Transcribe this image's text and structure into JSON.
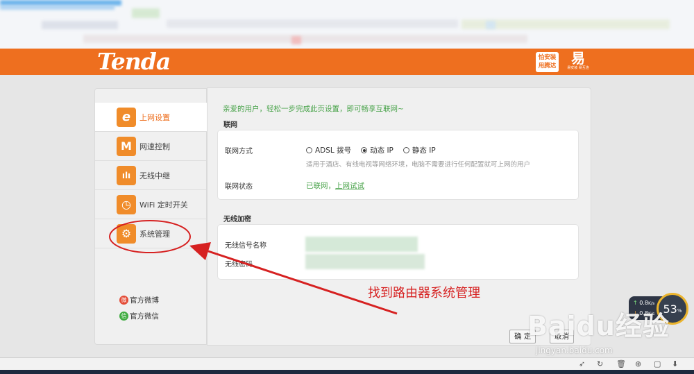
{
  "header": {
    "logo_text": "Tenda",
    "slogan_line1": "怕安装",
    "slogan_line2": "用腾达",
    "brand_icon": "易",
    "brand_sub": "易安装 易互连"
  },
  "sidebar": {
    "items": [
      {
        "label": "上网设置",
        "icon": "ie-e-icon",
        "glyph": "e"
      },
      {
        "label": "网速控制",
        "icon": "speed-wave-icon",
        "glyph": "M"
      },
      {
        "label": "无线中继",
        "icon": "wireless-repeater-icon",
        "glyph": "ılı"
      },
      {
        "label": "WiFi 定时开关",
        "icon": "wifi-timer-icon",
        "glyph": "◷"
      },
      {
        "label": "系统管理",
        "icon": "gear-icon",
        "glyph": "⚙"
      }
    ],
    "links": [
      {
        "label": "官方微博",
        "glyph": "微"
      },
      {
        "label": "官方微信",
        "glyph": "信"
      }
    ]
  },
  "main": {
    "welcome": "亲爱的用户，轻松一步完成此页设置，即可畅享互联网~",
    "internet": {
      "section_title": "联网",
      "mode_label": "联网方式",
      "options": [
        "ADSL 拨号",
        "动态 IP",
        "静态 IP"
      ],
      "selected": "动态 IP",
      "hint": "适用于酒店、有线电视等网络环境，电脑不需要进行任何配置就可上网的用户",
      "status_label": "联网状态",
      "status_text": "已联网，",
      "status_link": "上网试试"
    },
    "wireless": {
      "section_title": "无线加密",
      "ssid_label": "无线信号名称",
      "password_label": "无线密码"
    },
    "buttons": {
      "ok": "确 定",
      "cancel": "取消"
    }
  },
  "annotation": {
    "text": "找到路由器系统管理",
    "color": "#d62121"
  },
  "speed_widget": {
    "up": "0.8",
    "down": "0.8",
    "unit": "K/s",
    "percent": "53",
    "percent_sign": "%"
  },
  "watermark": {
    "main": "Baidu经验",
    "sub": "jingyan.baidu.com"
  },
  "colors": {
    "header_orange": "#ee6f1f",
    "accent_green": "#49a34a",
    "icon_orange": "#f08c2a"
  }
}
